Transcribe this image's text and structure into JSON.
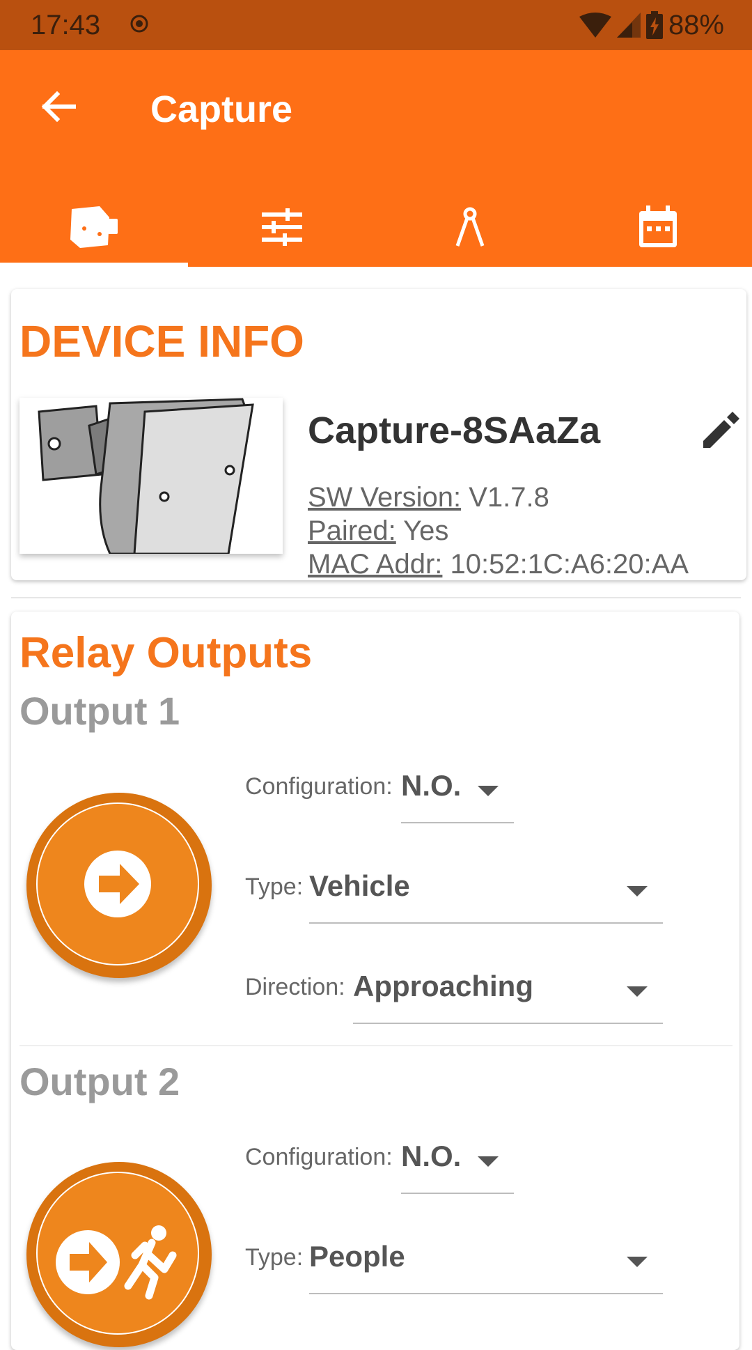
{
  "status_bar": {
    "time": "17:43",
    "battery": "88%"
  },
  "app_bar": {
    "title": "Capture"
  },
  "tabs": [
    {
      "name": "device",
      "icon": "device-sensor-icon",
      "selected": true
    },
    {
      "name": "settings",
      "icon": "sliders-icon",
      "selected": false
    },
    {
      "name": "installation",
      "icon": "compass-icon",
      "selected": false
    },
    {
      "name": "schedule",
      "icon": "calendar-icon",
      "selected": false
    }
  ],
  "device_info": {
    "section_title": "DEVICE INFO",
    "device_name": "Capture-8SAaZa",
    "sw_version_label": "SW Version:",
    "sw_version_value": "V1.7.8",
    "paired_label": "Paired:",
    "paired_value": "Yes",
    "mac_label": "MAC Addr:",
    "mac_value": "10:52:1C:A6:20:AA"
  },
  "relay_outputs": {
    "section_title": "Relay Outputs",
    "outputs": [
      {
        "title": "Output 1",
        "configuration_label": "Configuration:",
        "configuration_value": "N.O.",
        "type_label": "Type:",
        "type_value": "Vehicle",
        "direction_label": "Direction:",
        "direction_value": "Approaching",
        "icon": "arrow-right-icon"
      },
      {
        "title": "Output 2",
        "configuration_label": "Configuration:",
        "configuration_value": "N.O.",
        "type_label": "Type:",
        "type_value": "People",
        "icon": "arrow-person-icon"
      }
    ]
  },
  "colors": {
    "primary": "#fe6f16",
    "status_bar": "#b9500f",
    "accent_text": "#f5751c",
    "badge": "#ee861d"
  }
}
